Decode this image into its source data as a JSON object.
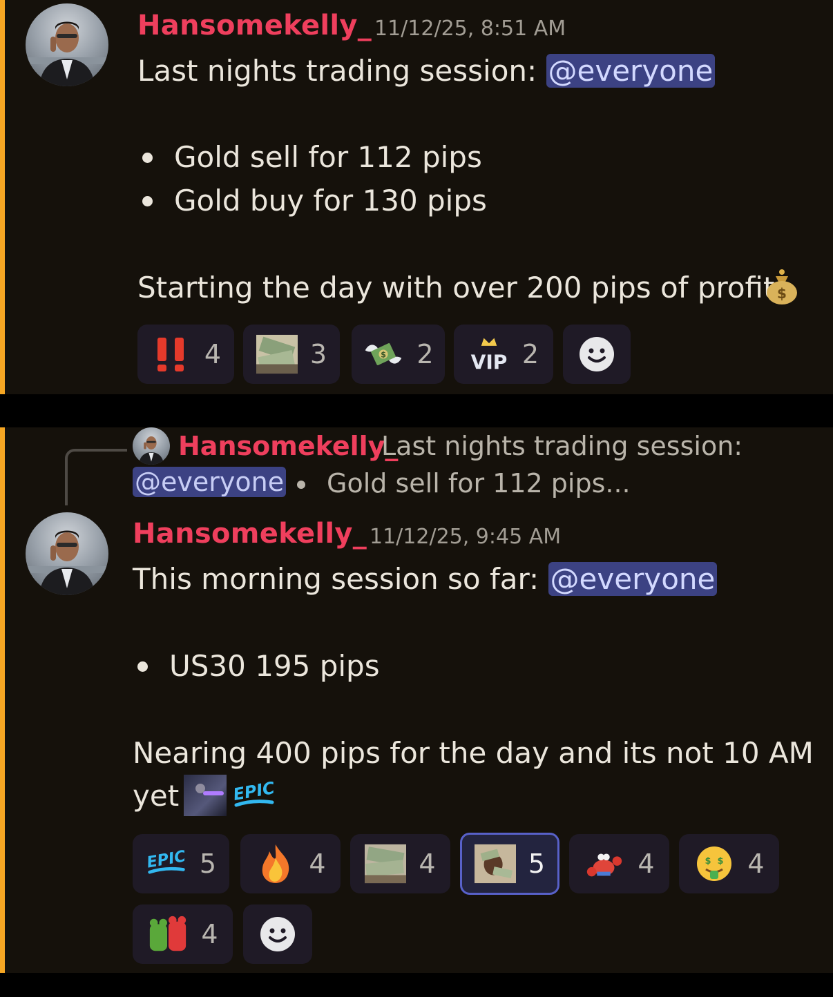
{
  "messages": [
    {
      "username": "Hansomekelly_",
      "timestamp": "11/12/25, 8:51 AM",
      "lead": "Last nights trading session:",
      "mention": "@everyone",
      "bullets": [
        "Gold sell for 112 pips",
        "Gold buy for 130 pips"
      ],
      "closing": "Starting the day with over 200 pips of profit",
      "closing_emoji": "money-bag-icon",
      "reactions": [
        {
          "emoji": "double-exclamation-icon",
          "count": "4"
        },
        {
          "emoji": "cash-photo-icon",
          "count": "3"
        },
        {
          "emoji": "money-with-wings-icon",
          "count": "2"
        },
        {
          "emoji": "vip-crown-icon",
          "count": "2"
        }
      ]
    },
    {
      "reply_to": {
        "username": "Hansomekelly_",
        "text": "Last nights trading session:",
        "mention": "@everyone",
        "snippet": "Gold sell for 112 pips..."
      },
      "username": "Hansomekelly_",
      "timestamp": "11/12/25, 9:45 AM",
      "lead": "This morning session so far:",
      "mention": "@everyone",
      "bullets": [
        "US30 195 pips"
      ],
      "closing_line1": "Nearing 400 pips for the day and its not 10 AM",
      "closing_line2": "yet",
      "epic_label": "EPIC",
      "reactions": [
        {
          "emoji": "epic-text-icon",
          "label": "EPIC",
          "count": "5",
          "active": false
        },
        {
          "emoji": "fire-icon",
          "count": "4",
          "active": false
        },
        {
          "emoji": "cash-photo-icon",
          "count": "4",
          "active": false
        },
        {
          "emoji": "person-money-photo-icon",
          "count": "5",
          "active": true
        },
        {
          "emoji": "crab-icon",
          "count": "4",
          "active": false
        },
        {
          "emoji": "money-mouth-face-icon",
          "count": "4",
          "active": false
        },
        {
          "emoji": "jelly-bears-icon",
          "count": "4",
          "active": false
        }
      ]
    }
  ],
  "colors": {
    "accent_bar": "#f5a623",
    "username": "#ef3f5d",
    "mention_bg": "#3c4283",
    "active_border": "#5861c9"
  }
}
